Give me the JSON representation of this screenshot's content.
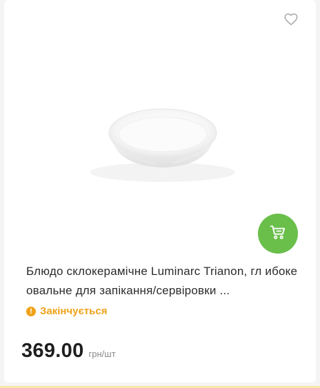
{
  "product": {
    "title": "Блюдо склокерамічне Luminarc Trianon, гл ибоке овальне для запікання/сервіровки ...",
    "status": "Закінчується",
    "price": "369.00",
    "unit": "грн/шт",
    "image_icon": "oval-dish-image"
  },
  "icons": {
    "favorite": "heart-outline-icon",
    "cart": "cart-icon",
    "status": "exclamation-circle-icon"
  },
  "colors": {
    "accent_green": "#6abf4b",
    "warning_orange": "#f0a21a",
    "price_text": "#1e1e1e",
    "unit_text": "#8a8a8a"
  }
}
